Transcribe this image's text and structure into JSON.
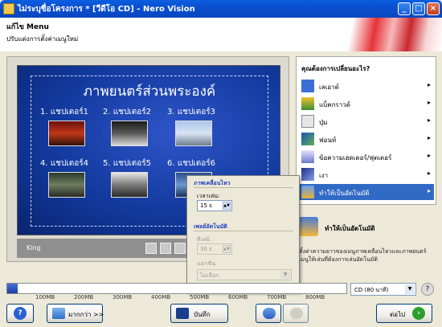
{
  "window": {
    "title": "ไม่ระบุชื่อโครงการ * [วีดีโอ CD] - Nero Vision",
    "minimize": "_",
    "maximize": "□",
    "close": "×"
  },
  "header": {
    "title": "แก้ไข Menu",
    "subtitle": "ปรับแต่งการตั้งค่าเมนูใหม่"
  },
  "preview": {
    "menu_title": "ภาพยนตร์ส่วนพระองค์",
    "chapters": [
      "1. แชปเตอร์1",
      "2. แชปเตอร์2",
      "3. แชปเตอร์3",
      "4. แชปเตอร์4",
      "5. แชปเตอร์5",
      "6. แชปเตอร์6"
    ],
    "control_label": "King"
  },
  "panel": {
    "title": "คุณต้องการเปลี่ยนอะไร?",
    "items": [
      {
        "label": "เลเอาต์",
        "icon": "layout-icon"
      },
      {
        "label": "แบ็คกราวด์",
        "icon": "background-icon"
      },
      {
        "label": "ปุ่ม",
        "icon": "button-icon"
      },
      {
        "label": "ฟอนท์",
        "icon": "font-icon"
      },
      {
        "label": "ข้อความเฮดเดอร์/ฟุตเตอร์",
        "icon": "header-footer-icon"
      },
      {
        "label": "เงา",
        "icon": "shadow-icon"
      },
      {
        "label": "ทำให้เป็นอัตโนมัติ",
        "icon": "autoplay-icon"
      }
    ],
    "arrow": "▸"
  },
  "autoplay": {
    "title": "ทำให้เป็นอัตโนมัติ",
    "description": "ตั้งค่าความยาวของเมนูภาพเคลื่อนไหวและภาพยนตร์เมนูให้เล่นที่ต้องการเล่นอัตโนมัติ"
  },
  "popup": {
    "group1_title": "ภาพเคลื่อนไหว",
    "duration_label": "เวลาเล่น:",
    "duration_value": "15 s",
    "group2_title": "เพลย์อัตโนมัติ",
    "wait_label": "ดีเลย์:",
    "wait_value": "30 s",
    "action_label": "แอกชัน:",
    "action_value": "ไม่เลือก"
  },
  "capacity": {
    "ticks": [
      "100MB",
      "200MB",
      "300MB",
      "400MB",
      "500MB",
      "600MB",
      "700MB",
      "800MB"
    ],
    "used_fraction": 0.03,
    "media": "CD (80 นาที)",
    "help": "?"
  },
  "buttons": {
    "help": "?",
    "more": "มากกว่า >>",
    "save": "บันทึก",
    "next": "ต่อไป",
    "next_icon": "›"
  },
  "colors": {
    "titlebar": "#0a4fd0",
    "selection": "#316ac5",
    "preview_bg": "#123a9e"
  }
}
